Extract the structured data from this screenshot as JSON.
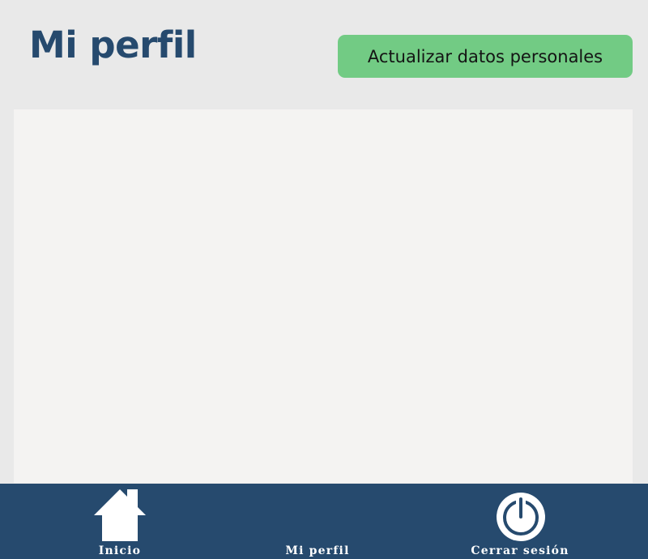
{
  "header": {
    "title": "Mi perfil",
    "update_button_label": "Actualizar datos personales"
  },
  "bottom_nav": {
    "items": [
      {
        "label": "Inicio",
        "icon": "home-icon"
      },
      {
        "label": "Mi perfil",
        "icon": ""
      },
      {
        "label": "Cerrar sesión",
        "icon": "power-icon"
      }
    ]
  },
  "colors": {
    "page_background": "#e9e9e9",
    "title": "#264a6e",
    "button_background": "#72cb84",
    "panel_background": "#f4f3f2",
    "nav_background": "#264a6e",
    "nav_text": "#ffffff"
  }
}
